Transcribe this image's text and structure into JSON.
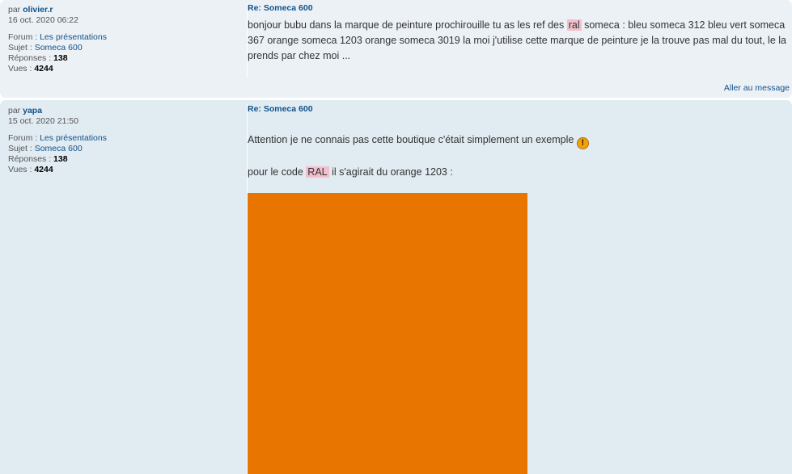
{
  "posts": [
    {
      "author_prefix": "par",
      "author": "olivier.r",
      "date": "16 oct. 2020 06:22",
      "forum_label": "Forum :",
      "forum": "Les présentations",
      "topic_label": "Sujet :",
      "topic": "Someca 600",
      "replies_label": "Réponses :",
      "replies": "138",
      "views_label": "Vues :",
      "views": "4244",
      "title": "Re: Someca 600",
      "text_before": "bonjour bubu dans la marque de peinture prochirouille tu as les ref des",
      "highlight": "ral",
      "text_after": "someca : bleu someca 312 bleu vert someca 367 orange someca 1203 orange someca 3019 la moi j'utilise cette marque de peinture je la trouve pas mal du tout, le la prends par chez moi ...",
      "goto_link": "Aller au message"
    },
    {
      "author_prefix": "par",
      "author": "yapa",
      "date": "15 oct. 2020 21:50",
      "forum_label": "Forum :",
      "forum": "Les présentations",
      "topic_label": "Sujet :",
      "topic": "Someca 600",
      "replies_label": "Réponses :",
      "replies": "138",
      "views_label": "Vues :",
      "views": "4244",
      "title": "Re: Someca 600",
      "line1": "Attention je ne connais pas cette boutique c'était simplement un exemple",
      "warn_icon": "!",
      "line2_before": "pour le code",
      "highlight": "RAL",
      "line2_after": "il s'agirait du orange 1203 :",
      "swatch_color": "#e87500"
    }
  ],
  "colors": {
    "link": "#105289",
    "post1_bg": "#ecf1f6",
    "post2_bg": "#e1ebf2",
    "highlight": "#f3bfcc"
  }
}
